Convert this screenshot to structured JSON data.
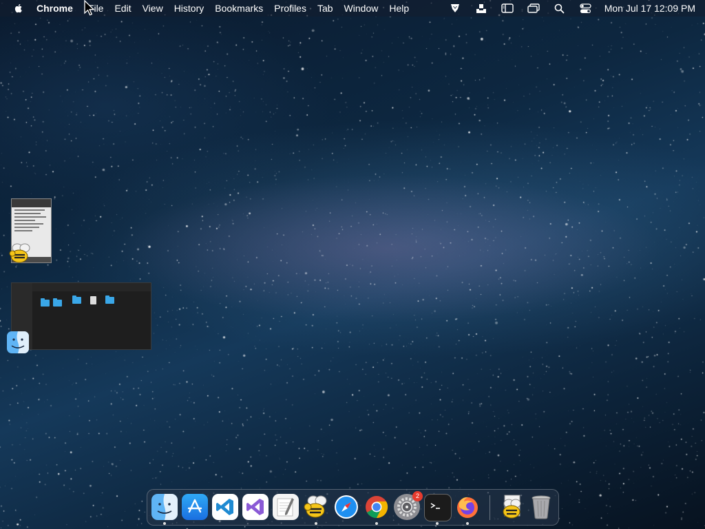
{
  "menubar": {
    "app_name": "Chrome",
    "items": [
      "File",
      "Edit",
      "View",
      "History",
      "Bookmarks",
      "Profiles",
      "Tab",
      "Window",
      "Help"
    ],
    "status_icons": [
      "app-status-icon",
      "upload-tray-icon",
      "sidebar-icon",
      "windows-icon",
      "search-icon",
      "control-center-icon"
    ],
    "clock": "Mon Jul 17  12:09 PM"
  },
  "dock": {
    "apps": [
      {
        "name": "finder",
        "running": true
      },
      {
        "name": "app-store",
        "running": false
      },
      {
        "name": "visual-studio-code",
        "running": false
      },
      {
        "name": "visual-studio",
        "running": false
      },
      {
        "name": "textedit",
        "running": false
      },
      {
        "name": "cyberduck",
        "running": true
      },
      {
        "name": "safari",
        "running": false
      },
      {
        "name": "chrome",
        "running": true
      },
      {
        "name": "system-preferences",
        "running": false,
        "badge": "2"
      },
      {
        "name": "terminal",
        "running": true
      },
      {
        "name": "firefox",
        "running": true
      },
      {
        "name": "cyberduck-document",
        "running": false
      },
      {
        "name": "trash",
        "running": false
      }
    ]
  },
  "colors": {
    "accent_blue": "#3aa7e8",
    "badge_red": "#e63b2e"
  }
}
